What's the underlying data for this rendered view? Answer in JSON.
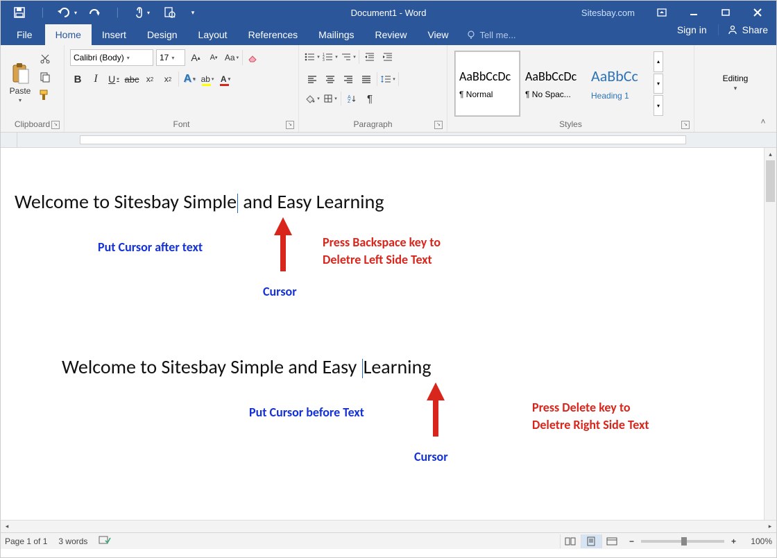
{
  "title": "Document1 - Word",
  "watermark": "Sitesbay.com",
  "menu": {
    "file": "File",
    "home": "Home",
    "insert": "Insert",
    "design": "Design",
    "layout": "Layout",
    "references": "References",
    "mailings": "Mailings",
    "review": "Review",
    "view": "View",
    "tellme": "Tell me...",
    "signin": "Sign in",
    "share": "Share"
  },
  "clipboard": {
    "paste": "Paste",
    "label": "Clipboard"
  },
  "font": {
    "family": "Calibri (Body)",
    "size": "17",
    "label": "Font"
  },
  "paragraph": {
    "label": "Paragraph"
  },
  "styles": {
    "label": "Styles",
    "items": [
      {
        "preview": "AaBbCcDc",
        "name": "¶ Normal",
        "color": "#000"
      },
      {
        "preview": "AaBbCcDc",
        "name": "¶ No Spac...",
        "color": "#000"
      },
      {
        "preview": "AaBbCc",
        "name": "Heading 1",
        "color": "#2e74b5"
      }
    ]
  },
  "editing": {
    "label": "Editing"
  },
  "document": {
    "line1_a": "Welcome to Sitesbay Simple",
    "line1_b": " and Easy Learning",
    "line2_a": "Welcome to Sitesbay Simple and Easy ",
    "line2_b": "Learning"
  },
  "annotations": {
    "put_after": "Put Cursor after text",
    "backspace": "Press Backspace key to\nDeletre Left Side Text",
    "cursor": "Cursor",
    "put_before": "Put Cursor before Text",
    "delete": "Press Delete key to\nDeletre Right Side Text"
  },
  "status": {
    "page": "Page 1 of 1",
    "words": "3 words",
    "zoom": "100%"
  }
}
